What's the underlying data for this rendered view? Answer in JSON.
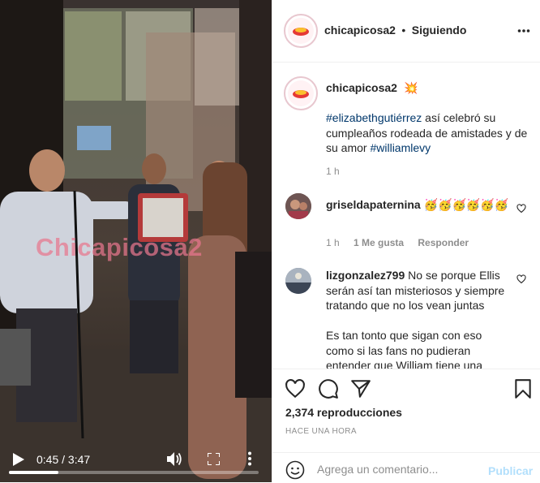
{
  "post": {
    "username": "chicapicosa2",
    "separator": "•",
    "follow_status": "Siguiendo"
  },
  "video": {
    "watermark": "Chicapicosa2",
    "current_time": "0:45",
    "time_separator": "/",
    "duration": "3:47",
    "progress": 0.198
  },
  "caption": {
    "username": "chicapicosa2",
    "emoji": "💥",
    "hashtag1": "#elizabethgutiérrez",
    "text": " así celebró su cumpleaños rodeada de amistades y de su amor ",
    "hashtag2": "#williamlevy",
    "time": "1 h"
  },
  "comments": [
    {
      "username": "griseldapaternina",
      "emoji": "🥳🥳🥳🥳🥳🥳",
      "time": "1 h",
      "likes": "1 Me gusta",
      "reply": "Responder"
    },
    {
      "username": "lizgonzalez799",
      "text_line1": " No se porque Ellis serán así tan misteriosos y siempre tratando que no los vean juntas",
      "text_line2": "Es tan tonto que sigan con eso como si las fans no pudieran entender que William tiene una"
    }
  ],
  "actions": {
    "views": "2,374 reproducciones",
    "time_ago": "HACE UNA HORA",
    "comment_placeholder": "Agrega un comentario...",
    "publish_label": "Publicar"
  },
  "icons": {
    "like": "heart-icon",
    "comment": "comment-bubble-icon",
    "share": "paper-plane-icon",
    "save": "bookmark-icon",
    "emoji": "smiley-icon",
    "options": "more-dots-icon"
  },
  "colors": {
    "link": "#00376b",
    "publish_disabled": "#b2dffc",
    "text": "#262626",
    "muted": "#8e8e8e",
    "watermark": "#e8768e"
  }
}
